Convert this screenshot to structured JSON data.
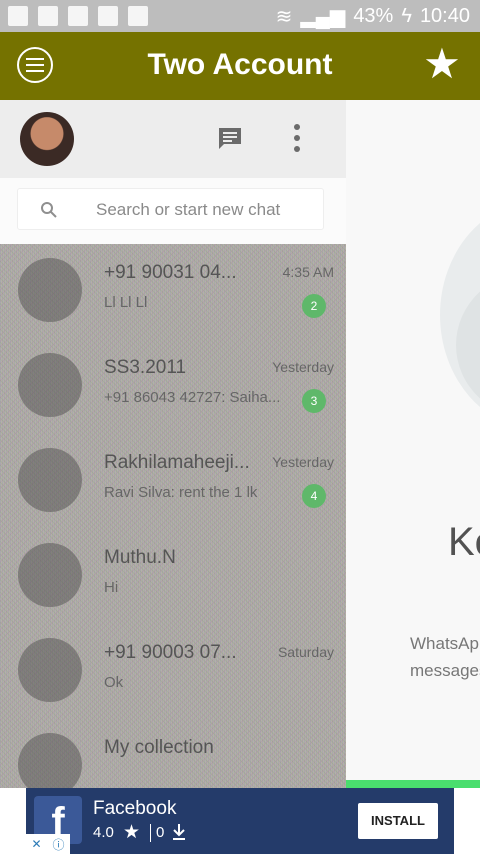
{
  "status_bar": {
    "battery": "43%",
    "time": "10:40"
  },
  "app_bar": {
    "title": "Two Account"
  },
  "search": {
    "placeholder": "Search or start new chat"
  },
  "chats": [
    {
      "name": "+91 90031 04...",
      "time": "4:35 AM",
      "preview": "Ll Ll Ll",
      "unread": "2"
    },
    {
      "name": "SS3.2011",
      "time": "Yesterday",
      "preview": "+91 86043 42727: Saiha...",
      "unread": "3"
    },
    {
      "name": "Rakhilamaheeji...",
      "time": "Yesterday",
      "preview": "Ravi Silva: rent the 1 lk",
      "unread": "4"
    },
    {
      "name": "Muthu.N",
      "time": "",
      "preview": "Hi",
      "unread": ""
    },
    {
      "name": "+91 90003 07...",
      "time": "Saturday",
      "preview": "Ok",
      "unread": ""
    },
    {
      "name": "My collection",
      "time": "",
      "preview": "",
      "unread": ""
    }
  ],
  "welcome": {
    "title": "Keep your phone connected",
    "description_line1": "WhatsApp connects to your phone to sync",
    "description_line2": "messages. To reduce data usage, connect your"
  },
  "ad": {
    "app_name": "Facebook",
    "rating": "4.0",
    "downloads": "0",
    "install_label": "INSTALL"
  },
  "colors": {
    "app_bar": "#757200",
    "ad_background": "#243b6a",
    "accent_green": "#4ade6e"
  }
}
